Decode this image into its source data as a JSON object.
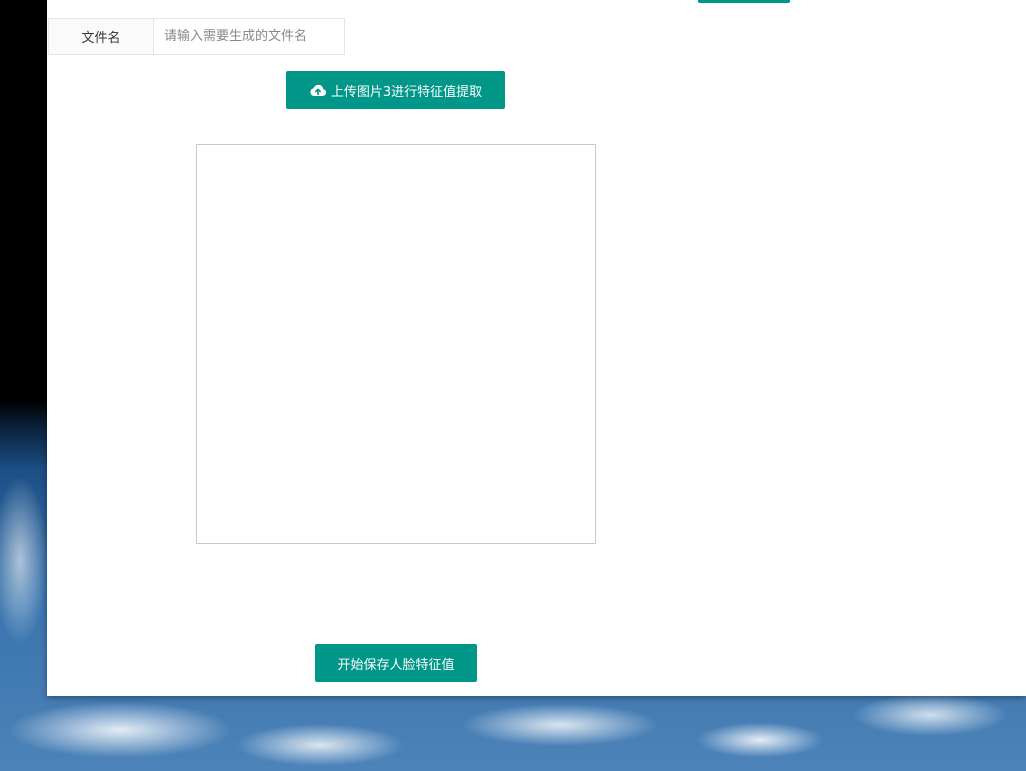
{
  "form": {
    "filename_label": "文件名",
    "filename_placeholder": "请输入需要生成的文件名",
    "filename_value": ""
  },
  "upload": {
    "label": "上传图片3进行特征值提取",
    "icon": "cloud-upload-icon"
  },
  "actions": {
    "save_label": "开始保存人脸特征值"
  },
  "colors": {
    "accent": "#009688",
    "border": "#e6e6e6",
    "preview_border": "#c8c8c8"
  }
}
